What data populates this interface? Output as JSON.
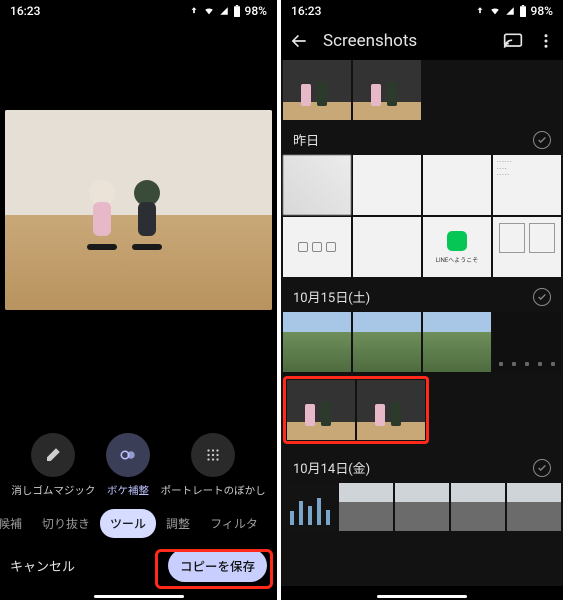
{
  "status": {
    "time": "16:23",
    "battery_pct": "98%"
  },
  "left": {
    "tools": [
      {
        "id": "magic-eraser",
        "label": "消しゴムマジック",
        "selected": false
      },
      {
        "id": "bokeh-correct",
        "label": "ボケ補整",
        "selected": true
      },
      {
        "id": "portrait-blur",
        "label": "ポートレートのぼかし",
        "selected": false
      }
    ],
    "tabs": {
      "partial_left": "候補",
      "items": [
        "切り抜き",
        "ツール",
        "調整"
      ],
      "partial_right": "フィルタ",
      "active": "ツール"
    },
    "cancel": "キャンセル",
    "save": "コピーを保存"
  },
  "right": {
    "title": "Screenshots",
    "sections": [
      {
        "key": "yesterday",
        "label": "昨日"
      },
      {
        "key": "oct15",
        "label": "10月15日(土)"
      },
      {
        "key": "oct14",
        "label": "10月14日(金)"
      }
    ],
    "line_caption": "LINEへようこそ"
  }
}
